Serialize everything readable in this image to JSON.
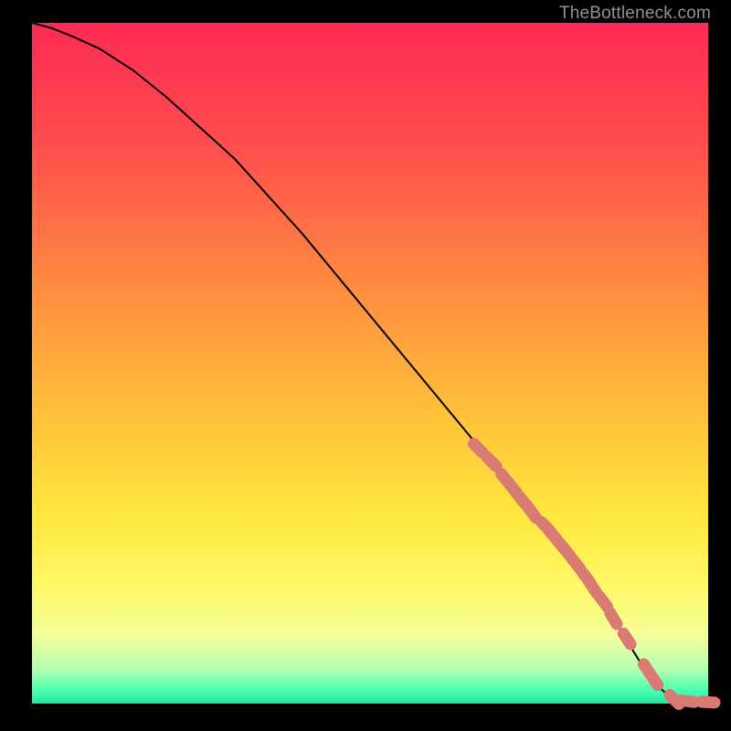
{
  "attribution": "TheBottleneck.com",
  "colors": {
    "bg": "#000000",
    "gradient": [
      {
        "stop": 0,
        "color": "#ff2a55"
      },
      {
        "stop": 18,
        "color": "#ff4d4d"
      },
      {
        "stop": 40,
        "color": "#ff8f3f"
      },
      {
        "stop": 58,
        "color": "#ffc23a"
      },
      {
        "stop": 73,
        "color": "#ffe93f"
      },
      {
        "stop": 83,
        "color": "#fff86a"
      },
      {
        "stop": 90,
        "color": "#f4ff9a"
      },
      {
        "stop": 95,
        "color": "#b4ffb4"
      },
      {
        "stop": 98,
        "color": "#4dffb0"
      },
      {
        "stop": 100,
        "color": "#1de9a0"
      }
    ],
    "curve": "#000000",
    "marker": "#d97a73"
  },
  "chart_data": {
    "type": "line",
    "title": "",
    "xlabel": "",
    "ylabel": "",
    "xlim": [
      0,
      100
    ],
    "ylim": [
      0,
      100
    ],
    "series": [
      {
        "name": "curve",
        "x": [
          0,
          3,
          6,
          10,
          15,
          20,
          30,
          40,
          50,
          60,
          70,
          80,
          85,
          90,
          92,
          95,
          98,
          100
        ],
        "y": [
          100,
          99.2,
          98,
          96.2,
          93,
          89,
          80,
          69,
          57,
          45,
          33,
          21,
          14,
          6,
          3,
          0.5,
          0.2,
          0.2
        ]
      }
    ],
    "markers": {
      "name": "highlighted-points",
      "x": [
        66,
        68,
        70,
        71,
        72,
        73,
        74,
        76,
        77,
        78,
        79,
        80.5,
        82,
        83,
        84.5,
        86,
        88,
        91,
        92,
        95,
        97,
        100
      ],
      "y": [
        37.5,
        35.5,
        33,
        31.8,
        30.5,
        29.3,
        28,
        26,
        24.8,
        23.6,
        22.4,
        20.5,
        18.5,
        17,
        15,
        12.5,
        9.5,
        5,
        3.5,
        0.6,
        0.35,
        0.2
      ]
    }
  }
}
